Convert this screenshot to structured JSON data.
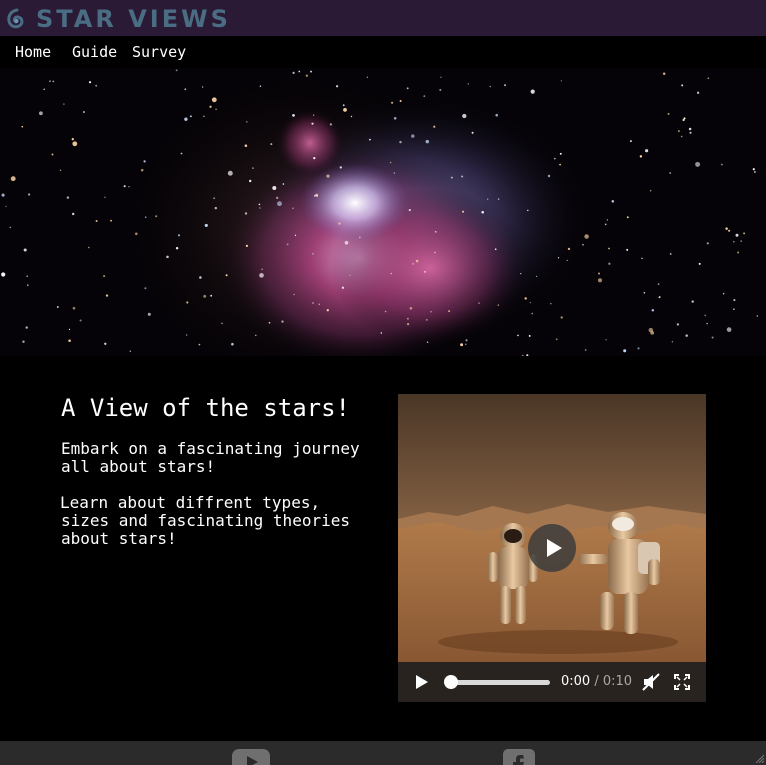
{
  "header": {
    "brand": "STAR VIEWS",
    "logo_icon": "swirl-logo-icon",
    "background": "#2a1a36",
    "brand_color": "#4a6d83"
  },
  "nav": {
    "items": [
      {
        "label": "Home"
      },
      {
        "label": "Guide"
      },
      {
        "label": "Survey"
      }
    ]
  },
  "hero": {
    "image": "orion-nebula-image"
  },
  "intro": {
    "heading": "A View of the stars!",
    "paragraph1_line1": "Embark on a fascinating journey",
    "paragraph1_line2": "all about stars!",
    "paragraph2_line1": "Learn about diffrent types,",
    "paragraph2_line2": "sizes and fascinating theories",
    "paragraph2_line3": "about stars!"
  },
  "video": {
    "thumbnail": "astronauts-on-mars-image",
    "current_time": "0:00",
    "separator": " / ",
    "duration": "0:10",
    "progress": 0,
    "muted": true,
    "icons": [
      "play-icon",
      "mute-icon",
      "fullscreen-icon"
    ]
  },
  "footer": {
    "icons": [
      "youtube-icon",
      "facebook-icon"
    ]
  }
}
